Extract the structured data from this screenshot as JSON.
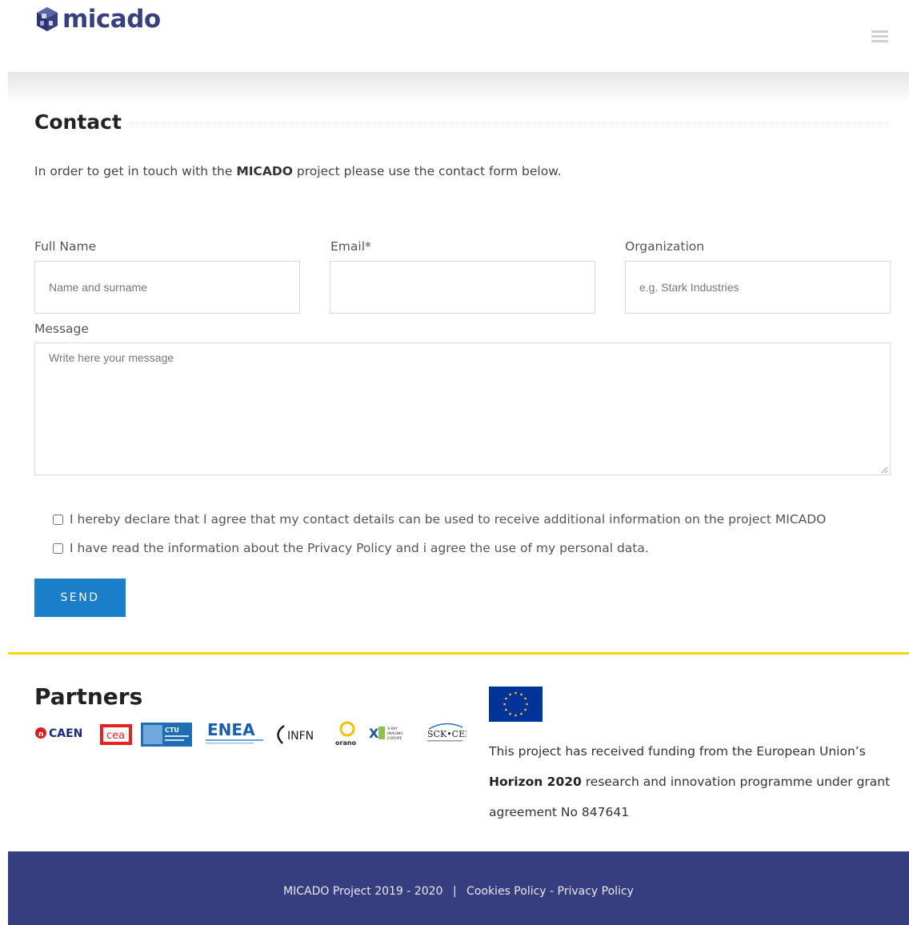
{
  "header": {
    "logo_text": "micado",
    "logo_icon": "micado-cube-icon",
    "menu_icon": "hamburger-menu-icon"
  },
  "contact": {
    "title": "Contact",
    "intro_before": "In order to get in touch with the ",
    "intro_bold": "MICADO",
    "intro_after": " project please use the contact form below."
  },
  "form": {
    "full_name_label": "Full Name",
    "full_name_placeholder": "Name and surname",
    "email_label": "Email*",
    "email_placeholder": "",
    "organization_label": "Organization",
    "organization_placeholder": "e.g. Stark Industries",
    "message_label": "Message",
    "message_placeholder": "Write here your message",
    "consent_1": "I hereby declare that I agree that my contact details can be used to receive additional information on the project MICADO",
    "consent_2": "I have read the information about the Privacy Policy and i agree the use of my personal data.",
    "send_label": "SEND"
  },
  "partners": {
    "title": "Partners",
    "logos": [
      "CAEN",
      "cea",
      "CTU",
      "ENEA",
      "INFN",
      "orano",
      "X-RAY IMAGING EUROPE",
      "SCK•CEN"
    ]
  },
  "funding": {
    "line_before": "This project has received funding from the European Union’s ",
    "bold": "Horizon 2020",
    "line_after": " research and innovation programme under grant agreement No 847641"
  },
  "footer": {
    "copyright": "MICADO Project 2019 - 2020",
    "separator": "|",
    "cookies": "Cookies Policy",
    "dash": " - ",
    "privacy": "Privacy Policy"
  },
  "colors": {
    "brand_navy": "#373e80",
    "accent_blue": "#1a7fc8",
    "divider_yellow": "#f6d60e"
  }
}
